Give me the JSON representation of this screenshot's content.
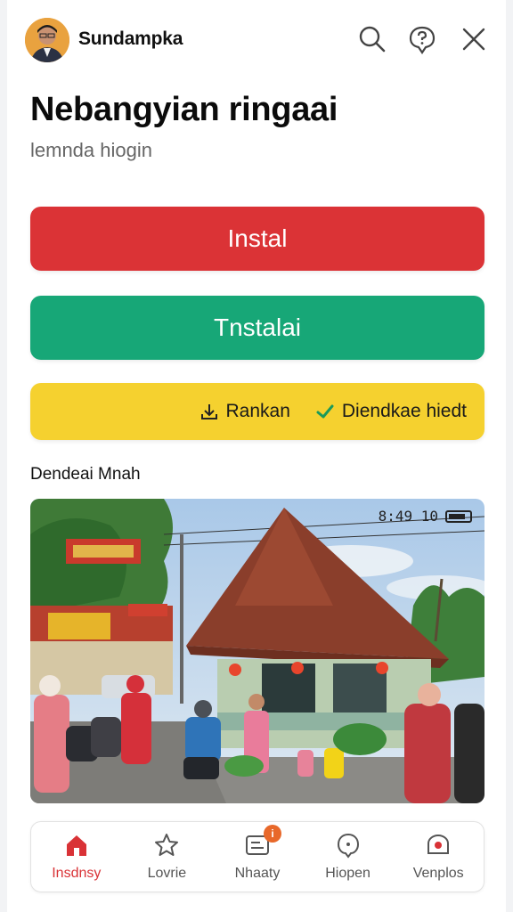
{
  "header": {
    "app_name": "Sundampka",
    "icons": [
      "search-icon",
      "help-icon",
      "close-icon"
    ]
  },
  "main": {
    "title": "Nebangyian ringaai",
    "subtitle": "lemnda hiogin"
  },
  "buttons": {
    "red_label": "Instal",
    "green_label": "Tnstalai",
    "yellow_left_label": "Rankan",
    "yellow_right_label": "Diendkae hiedt"
  },
  "section": {
    "label": "Dendeai Mnah"
  },
  "photo": {
    "status_text": "8:49 10",
    "sign_text": "",
    "icons": [
      "battery-icon"
    ]
  },
  "bottom_nav": {
    "items": [
      {
        "label": "Insdnsy",
        "icon": "home-icon",
        "active": true
      },
      {
        "label": "Lovrie",
        "icon": "star-icon"
      },
      {
        "label": "Nhaaty",
        "icon": "message-icon",
        "badge": "i"
      },
      {
        "label": "Hiopen",
        "icon": "chat-icon"
      },
      {
        "label": "Venplos",
        "icon": "camera-icon"
      }
    ]
  },
  "colors": {
    "red": "#db3336",
    "green": "#17a777",
    "yellow": "#f5d12f",
    "accent": "#d93236",
    "badge": "#e8682a"
  }
}
